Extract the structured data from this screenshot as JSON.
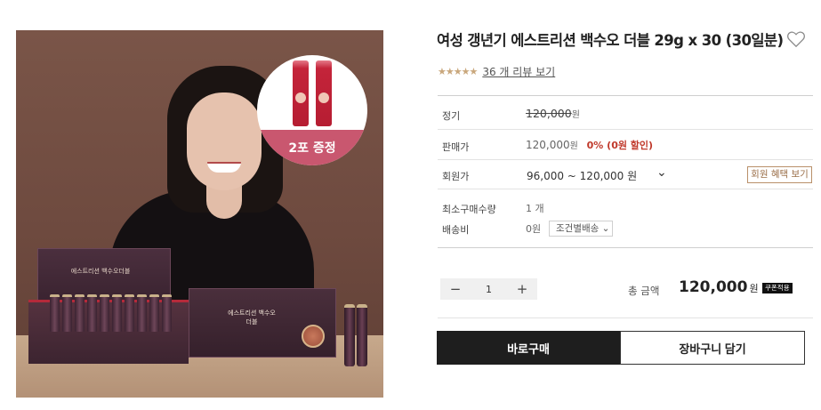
{
  "product": {
    "title": "여성 갱년기 에스트리션 백수오 더블 29g x 30 (30일분)",
    "rating_stars": "★★★★★",
    "review_link": "36 개 리뷰 보기",
    "gift_badge": "2포 증정",
    "box_lid_text": "에스트리션 백수오더블",
    "box_front_text": "에스트리션 백수오더블"
  },
  "info": {
    "regular_label": "정기",
    "regular_price": "120,000",
    "won": "원",
    "sale_label": "판매가",
    "sale_price": "120,000",
    "discount": "0% (0원 할인)",
    "member_label": "회원가",
    "member_range": "96,000 ~ 120,000 원",
    "member_benefit_button": "회원 혜택 보기",
    "min_qty_label": "최소구매수량",
    "min_qty_value": "1 개",
    "shipping_label": "배송비",
    "shipping_value": "0원",
    "shipping_option": "조건별배송 ⌄"
  },
  "order": {
    "quantity": "1",
    "minus": "−",
    "plus": "+",
    "total_label": "총 금액",
    "total_amount": "120,000",
    "coupon_badge": "쿠폰적용",
    "buy_now": "바로구매",
    "add_to_cart": "장바구니 담기"
  },
  "colors": {
    "accent": "#c9a77c",
    "discount": "#c0392b",
    "buy_button": "#1e1e1e"
  }
}
